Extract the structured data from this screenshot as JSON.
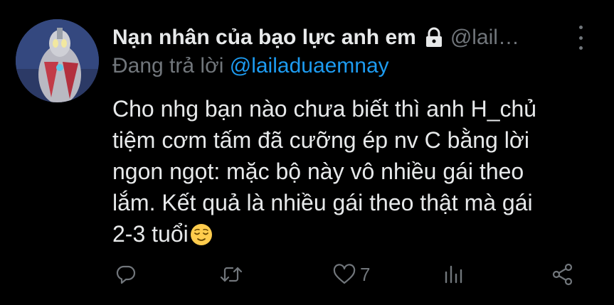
{
  "author": {
    "display_name": "Nạn nhân của bạo lực anh em",
    "handle": "@lail…",
    "protected_icon": "lock-icon",
    "avatar": "avatar-image"
  },
  "reply_context": {
    "prefix": "Đang trả lời ",
    "mention": "@lailaduaemnay"
  },
  "tweet": {
    "text_lines": [
      "Cho nhg bạn nào chưa biết thì anh H_chủ",
      "tiệm cơm tấm đã cưỡng ép nv C bằng lời",
      "ngon ngọt: mặc bộ này vô nhiều gái theo",
      "lắm. Kết quả là nhiều gái theo thật mà gái",
      "2-3 tuổi"
    ],
    "emoji": "relieved-face-emoji"
  },
  "actions": {
    "reply": {
      "icon": "reply-icon"
    },
    "retweet": {
      "icon": "retweet-icon"
    },
    "like": {
      "icon": "heart-icon",
      "count": "7"
    },
    "analytics": {
      "icon": "analytics-icon"
    },
    "share": {
      "icon": "share-icon"
    }
  },
  "more_icon": "more-vertical-icon",
  "colors": {
    "background": "#000000",
    "primary_text": "#e7e9ea",
    "secondary_text": "#71767b",
    "link": "#1d9bf0"
  }
}
